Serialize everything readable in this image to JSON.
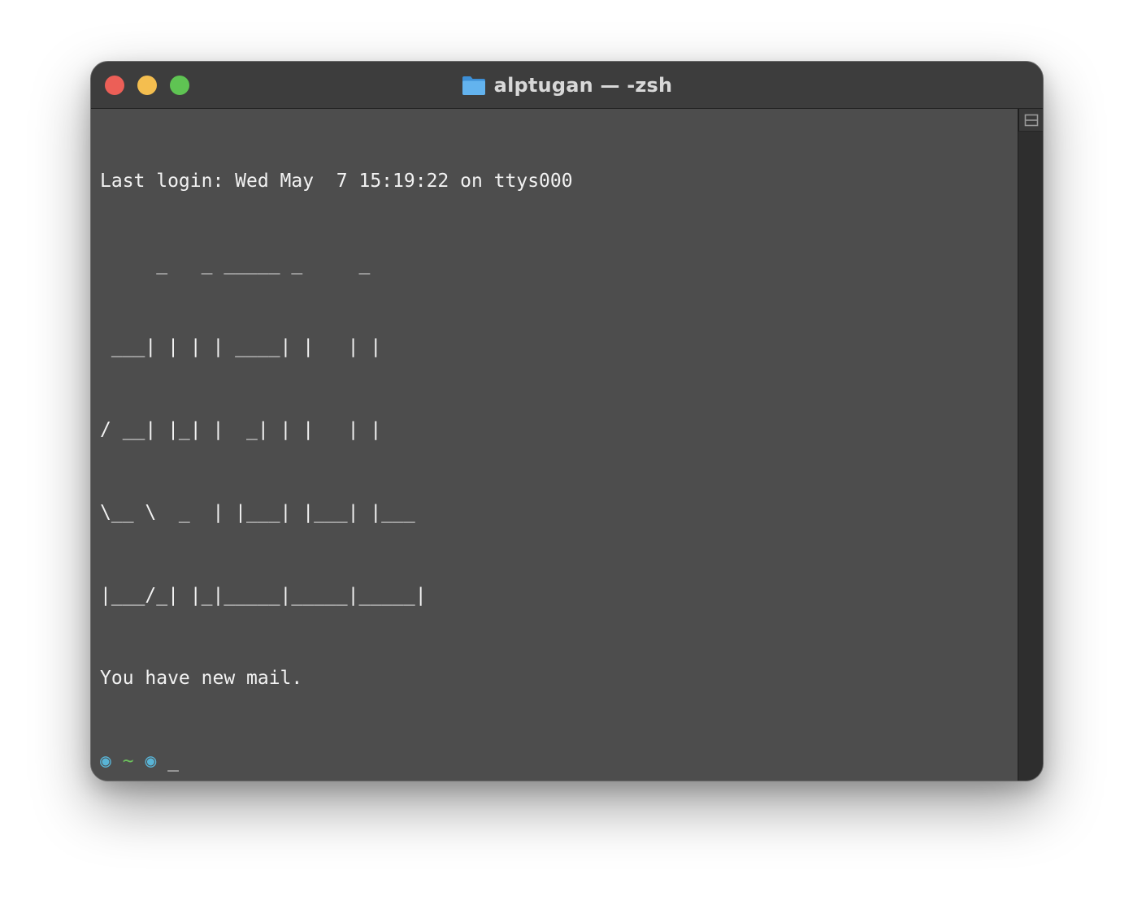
{
  "window": {
    "title": "alptugan — -zsh",
    "controls": {
      "close_color": "#ec5f57",
      "minimize_color": "#f4be4f",
      "zoom_color": "#5fc453"
    }
  },
  "terminal": {
    "last_login": "Last login: Wed May  7 15:19:22 on ttys000",
    "banner": [
      "     _   _ _____ _     _",
      " ___| | | | ____| |   | |",
      "/ __| |_| |  _| | |   | |",
      "\\__ \\  _  | |___| |___| |___",
      "|___/_| |_|_____|_____|_____|"
    ],
    "mail_notice": "You have new mail.",
    "prompt": {
      "left_symbol": "◉",
      "directory": "~",
      "right_symbol": "◉",
      "cursor": "_"
    }
  },
  "colors": {
    "prompt_symbol": "#59b4d6",
    "prompt_directory": "#6cc25c",
    "text": "#f2f2f2",
    "background": "#4d4d4d"
  }
}
